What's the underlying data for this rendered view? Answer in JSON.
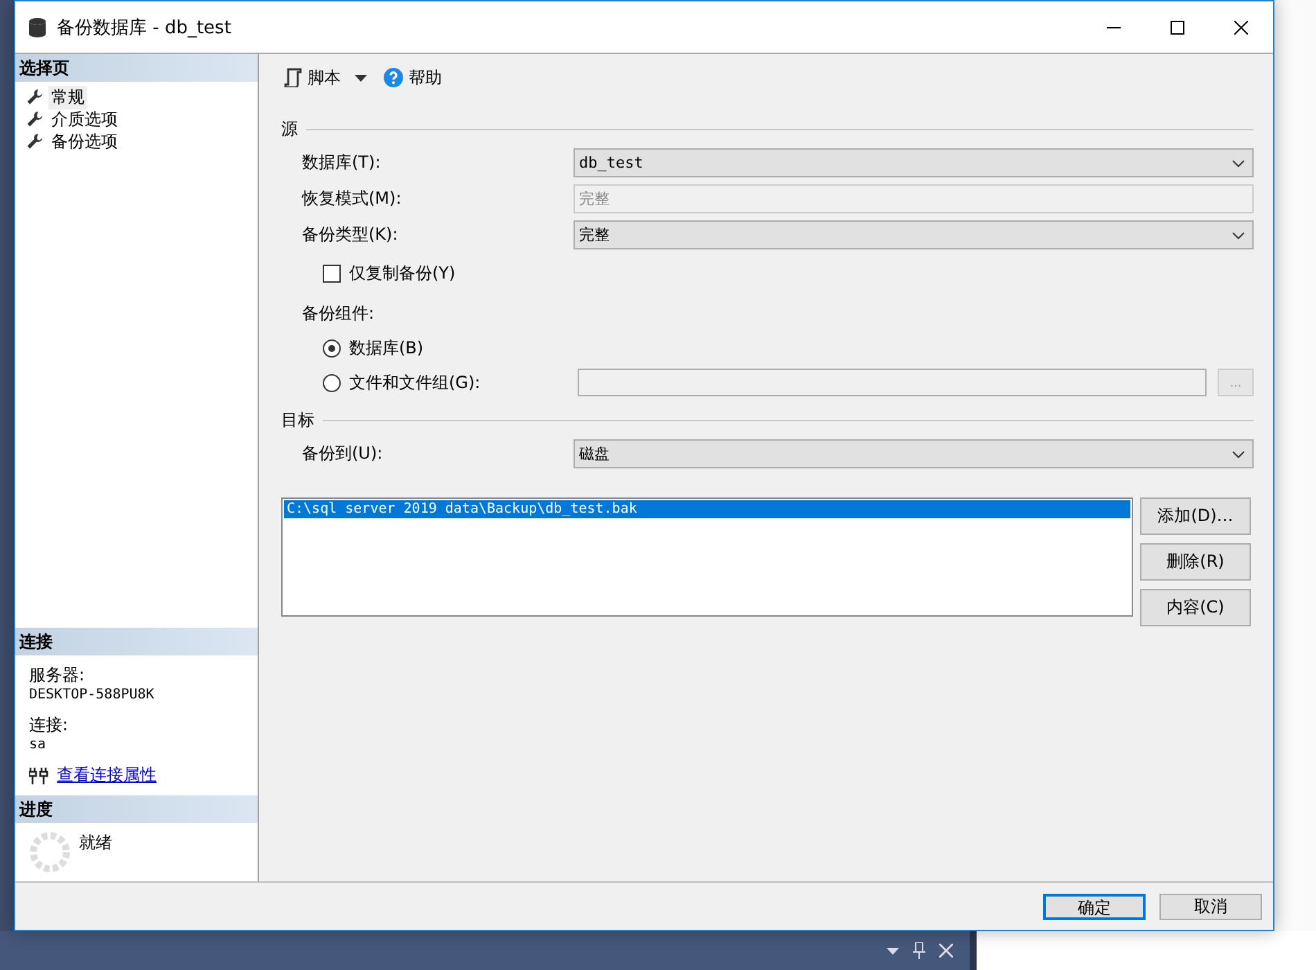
{
  "window": {
    "title": "备份数据库 - db_test"
  },
  "sidebar": {
    "select_page": {
      "heading": "选择页",
      "items": [
        {
          "label": "常规",
          "selected": true
        },
        {
          "label": "介质选项",
          "selected": false
        },
        {
          "label": "备份选项",
          "selected": false
        }
      ]
    },
    "connection": {
      "heading": "连接",
      "server_label": "服务器:",
      "server": "DESKTOP-588PU8K",
      "connection_label": "连接:",
      "connection": "sa",
      "link": "查看连接属性"
    },
    "progress": {
      "heading": "进度",
      "status": "就绪"
    }
  },
  "toolbar": [
    {
      "label": "脚本",
      "kind": "script"
    },
    {
      "label": "帮助",
      "kind": "help"
    }
  ],
  "source": {
    "heading": "源",
    "fields": [
      {
        "label": "数据库(T):",
        "value": "db_test",
        "kind": "dropdown",
        "disabled": false
      },
      {
        "label": "恢复模式(M):",
        "value": "完整",
        "kind": "text",
        "disabled": true
      },
      {
        "label": "备份类型(K):",
        "value": "完整",
        "kind": "dropdown",
        "disabled": false
      }
    ],
    "copy_only": {
      "label": "仅复制备份(Y)",
      "checked": false
    },
    "component_label": "备份组件:",
    "components": [
      {
        "label": "数据库(B)",
        "selected": true
      },
      {
        "label": "文件和文件组(G):",
        "selected": false
      }
    ],
    "browse_button": {
      "label": "...",
      "disabled": true
    }
  },
  "destination": {
    "heading": "目标",
    "backup_to_label": "备份到(U):",
    "backup_to": "磁盘",
    "files": [
      {
        "path": "C:\\sql server 2019 data\\Backup\\db_test.bak",
        "selected": true
      }
    ],
    "buttons": [
      "添加(D)…",
      "删除(R)",
      "内容(C)"
    ]
  },
  "footer": {
    "buttons": [
      {
        "label": "确定",
        "default": true
      },
      {
        "label": "取消",
        "default": false
      }
    ]
  }
}
